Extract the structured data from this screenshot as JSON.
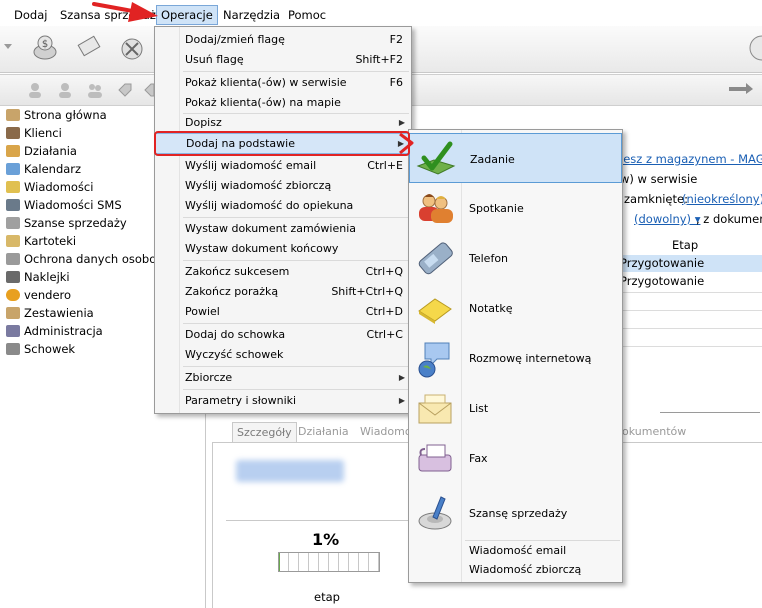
{
  "menubar": {
    "items": [
      "Dodaj",
      "Szansa sprzedaży",
      "Operacje",
      "Narzędzia",
      "Pomoc"
    ]
  },
  "nav": {
    "items": [
      {
        "label": "Strona główna",
        "color": "#c8a46a"
      },
      {
        "label": "Klienci",
        "color": "#8a6a4a"
      },
      {
        "label": "Działania",
        "color": "#d9a54a"
      },
      {
        "label": "Kalendarz",
        "color": "#6aa0d8"
      },
      {
        "label": "Wiadomości",
        "color": "#e0c050"
      },
      {
        "label": "Wiadomości SMS",
        "color": "#6a7a8a"
      },
      {
        "label": "Szanse sprzedaży",
        "color": "#a0a0a0"
      },
      {
        "label": "Kartoteki",
        "color": "#d8b868"
      },
      {
        "label": "Ochrona danych osobowych",
        "color": "#9a9a9a"
      },
      {
        "label": "Naklejki",
        "color": "#6a6a6a"
      },
      {
        "label": "vendero",
        "color": "#e8a020"
      },
      {
        "label": "Zestawienia",
        "color": "#c8a46a"
      },
      {
        "label": "Administracja",
        "color": "#7a7aa0"
      },
      {
        "label": "Schowek",
        "color": "#8a8a8a"
      }
    ]
  },
  "content": {
    "link": "jesz z magazynem - MAG - Gł",
    "text_serwis": "w) w serwisie",
    "zamkniete_label": "zamknięte:",
    "zamkniete_value": "(nieokreślony) ▾",
    "dowolny_value": "(dowolny) ▾",
    "dokumenty_text": ", z dokumenten",
    "colon": ":",
    "etap_header": "Etap",
    "rows": [
      "Przygotowanie",
      "Przygotowanie"
    ],
    "tabs": [
      "Szczegóły",
      "Działania",
      "Wiadomo",
      "okumentów"
    ],
    "progress_value": "1%",
    "progress_fraction": 0.01,
    "etap_label": "etap"
  },
  "menu": {
    "items": [
      {
        "label": "Dodaj/zmień flagę",
        "shortcut": "F2"
      },
      {
        "label": "Usuń flagę",
        "shortcut": "Shift+F2"
      },
      {
        "label": "Pokaż klienta(-ów) w serwisie",
        "shortcut": "F6"
      },
      {
        "label": "Pokaż klienta(-ów) na mapie",
        "shortcut": ""
      },
      {
        "label": "Dopisz",
        "shortcut": "",
        "submenu": true
      },
      {
        "label": "Dodaj na podstawie",
        "shortcut": "",
        "submenu": true,
        "selected": true
      },
      {
        "label": "Wyślij wiadomość email",
        "shortcut": "Ctrl+E"
      },
      {
        "label": "Wyślij wiadomość zbiorczą",
        "shortcut": ""
      },
      {
        "label": "Wyślij wiadomość do opiekuna",
        "shortcut": ""
      },
      {
        "label": "Wystaw dokument zamówienia",
        "shortcut": ""
      },
      {
        "label": "Wystaw dokument końcowy",
        "shortcut": ""
      },
      {
        "label": "Zakończ sukcesem",
        "shortcut": "Ctrl+Q"
      },
      {
        "label": "Zakończ porażką",
        "shortcut": "Shift+Ctrl+Q"
      },
      {
        "label": "Powiel",
        "shortcut": "Ctrl+D"
      },
      {
        "label": "Dodaj do schowka",
        "shortcut": "Ctrl+C"
      },
      {
        "label": "Wyczyść schowek",
        "shortcut": ""
      },
      {
        "label": "Zbiorcze",
        "shortcut": "",
        "submenu": true
      },
      {
        "label": "Parametry i słowniki",
        "shortcut": "",
        "submenu": true
      }
    ]
  },
  "submenu": {
    "items": [
      {
        "label": "Zadanie",
        "icon": "task-check-icon",
        "selected": true
      },
      {
        "label": "Spotkanie",
        "icon": "meeting-people-icon"
      },
      {
        "label": "Telefon",
        "icon": "phone-icon"
      },
      {
        "label": "Notatkę",
        "icon": "note-icon"
      },
      {
        "label": "Rozmowę internetową",
        "icon": "chat-icon"
      },
      {
        "label": "List",
        "icon": "letter-icon"
      },
      {
        "label": "Fax",
        "icon": "fax-icon"
      },
      {
        "label": "Szansę sprzedaży",
        "icon": "sales-opportunity-icon"
      }
    ],
    "text_items": [
      "Wiadomość email",
      "Wiadomość zbiorczą"
    ]
  },
  "colors": {
    "highlight": "#cfe3f7",
    "annotation_red": "#e12323"
  }
}
